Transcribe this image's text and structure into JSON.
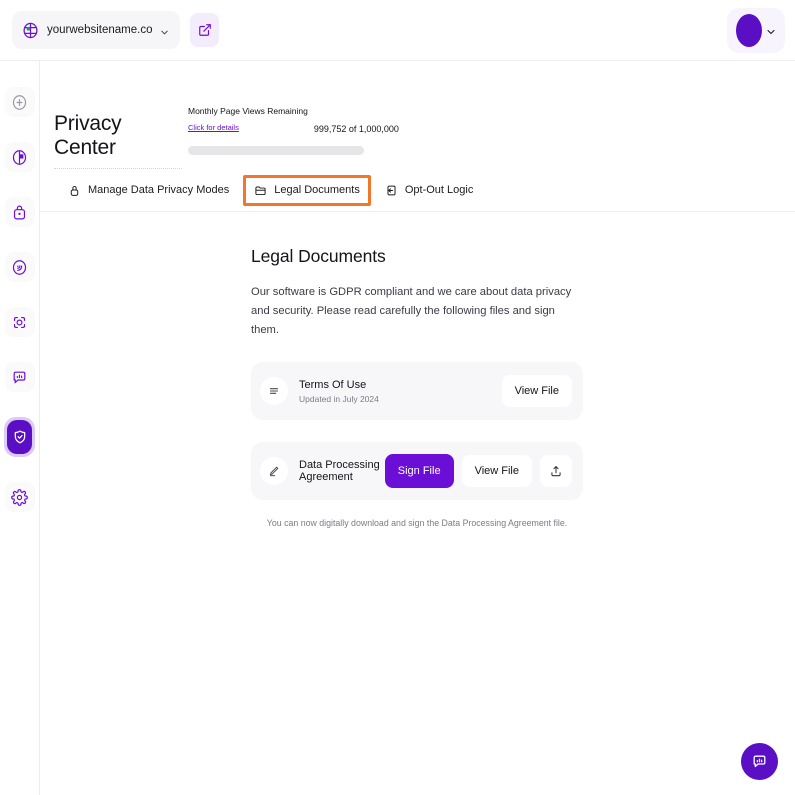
{
  "topbar": {
    "site_selector": {
      "name": "yourwebsitename.co",
      "globe_icon": "globe-icon",
      "chevron_icon": "chevron-down-icon"
    },
    "external_link_button": {
      "icon": "external-link-icon"
    },
    "account": {
      "avatar": "user-avatar",
      "chevron_icon": "chevron-down-icon"
    }
  },
  "sidebar": {
    "items": [
      {
        "name": "add-circle-icon",
        "state": "muted"
      },
      {
        "name": "analytics-icon",
        "state": "purple"
      },
      {
        "name": "lock-bag-icon",
        "state": "purple"
      },
      {
        "name": "signal-icon",
        "state": "purple"
      },
      {
        "name": "scan-target-icon",
        "state": "purple"
      },
      {
        "name": "chat-bubble-icon",
        "state": "purple"
      },
      {
        "name": "shield-check-icon",
        "state": "active"
      },
      {
        "name": "gear-icon",
        "state": "purple"
      }
    ]
  },
  "header": {
    "title": "Privacy Center",
    "quota": {
      "label": "Monthly Page Views Remaining",
      "link": "Click for details",
      "count": "999,752 of 1,000,000",
      "percent": 99.97
    }
  },
  "tabs": [
    {
      "label": "Manage Data Privacy Modes",
      "icon": "lock-icon",
      "highlighted": false
    },
    {
      "label": "Legal Documents",
      "icon": "folder-icon",
      "highlighted": true
    },
    {
      "label": "Opt-Out Logic",
      "icon": "toggle-square-icon",
      "highlighted": false
    }
  ],
  "main": {
    "title": "Legal Documents",
    "description": "Our software is GDPR compliant and we care about data privacy and security. Please read carefully the following files and sign them.",
    "documents": [
      {
        "name": "Terms Of Use",
        "subtitle": "Updated in July 2024",
        "icon": "document-lines-icon",
        "view_label": "View File"
      },
      {
        "name": "Data Processing Agreement",
        "subtitle": "",
        "icon": "pen-edit-icon",
        "sign_label": "Sign File",
        "view_label": "View File",
        "upload_icon": "upload-icon"
      }
    ],
    "note": "You can now digitally download and sign the Data Processing Agreement file."
  },
  "support": {
    "fab_icon": "chat-support-icon"
  },
  "colors": {
    "brand_purple": "#6b0fd7",
    "deep_purple": "#5b0fc4",
    "highlight_orange": "#f2772a",
    "card_grey": "#f7f7f9"
  }
}
